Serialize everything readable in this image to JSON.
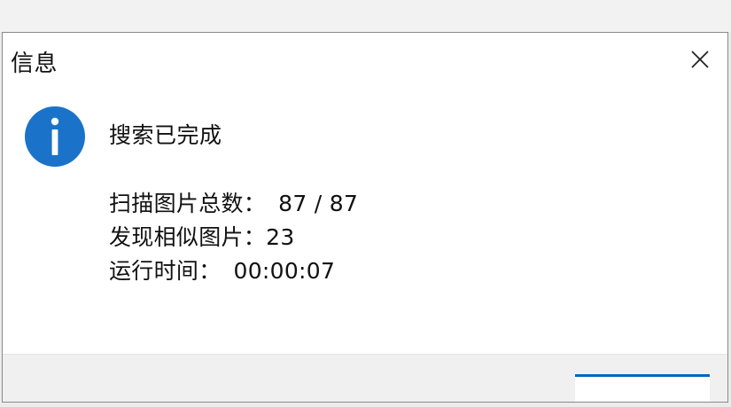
{
  "dialog": {
    "title": "信息",
    "close_icon": "close-icon",
    "info_icon": "info-icon",
    "accent_color": "#0067c0",
    "icon_color": "#1a73c8",
    "heading": "搜索已完成",
    "details": [
      {
        "label": "扫描图片总数：",
        "value": "87 / 87"
      },
      {
        "label": "发现相似图片：",
        "value": "23"
      },
      {
        "label": "运行时间：",
        "value": "00:00:07"
      }
    ]
  }
}
